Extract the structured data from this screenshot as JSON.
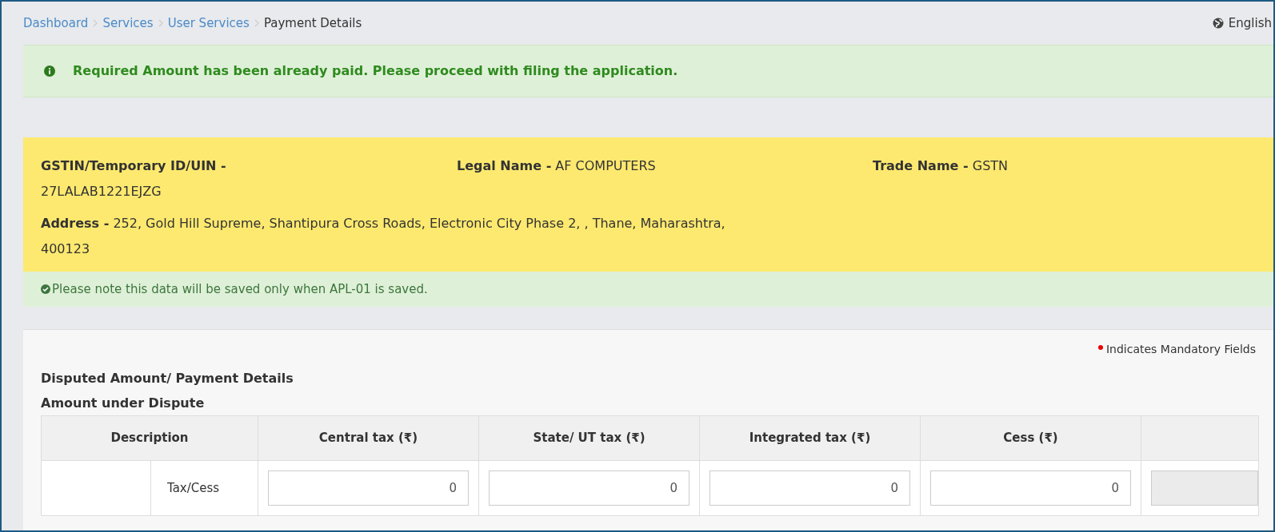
{
  "breadcrumb": [
    {
      "label": "Dashboard",
      "link": true
    },
    {
      "label": "Services",
      "link": true
    },
    {
      "label": "User Services",
      "link": true
    },
    {
      "label": "Payment Details",
      "link": false
    }
  ],
  "language": "English",
  "alert": {
    "message": "Required Amount has been already paid. Please proceed with filing the application."
  },
  "taxpayer": {
    "fields": [
      {
        "label": "GSTIN/Temporary ID/UIN -",
        "value": "27LALAB1221EJZG"
      },
      {
        "label": "Legal Name -",
        "value": "AF COMPUTERS"
      },
      {
        "label": "Trade Name -",
        "value": "GSTN"
      }
    ],
    "address": {
      "label": "Address -",
      "value": "252, Gold Hill Supreme, Shantipura Cross Roads, Electronic City Phase 2, , Thane, Maharashtra, 400123"
    }
  },
  "note": "Please note this data will be saved only when APL-01 is saved.",
  "mandatory_note": "Indicates Mandatory Fields",
  "section_title": "Disputed Amount/ Payment Details",
  "subsection_title": "Amount under Dispute",
  "table": {
    "columns": [
      "Description",
      "Central tax (₹)",
      "State/ UT tax (₹)",
      "Integrated tax (₹)",
      "Cess (₹)"
    ],
    "rows": [
      {
        "label": "Tax/Cess",
        "inputs": [
          {
            "value": "0",
            "disabled": false
          },
          {
            "value": "0",
            "disabled": false
          },
          {
            "value": "0",
            "disabled": false
          },
          {
            "value": "0",
            "disabled": false
          },
          {
            "disabled": true
          }
        ]
      }
    ]
  }
}
